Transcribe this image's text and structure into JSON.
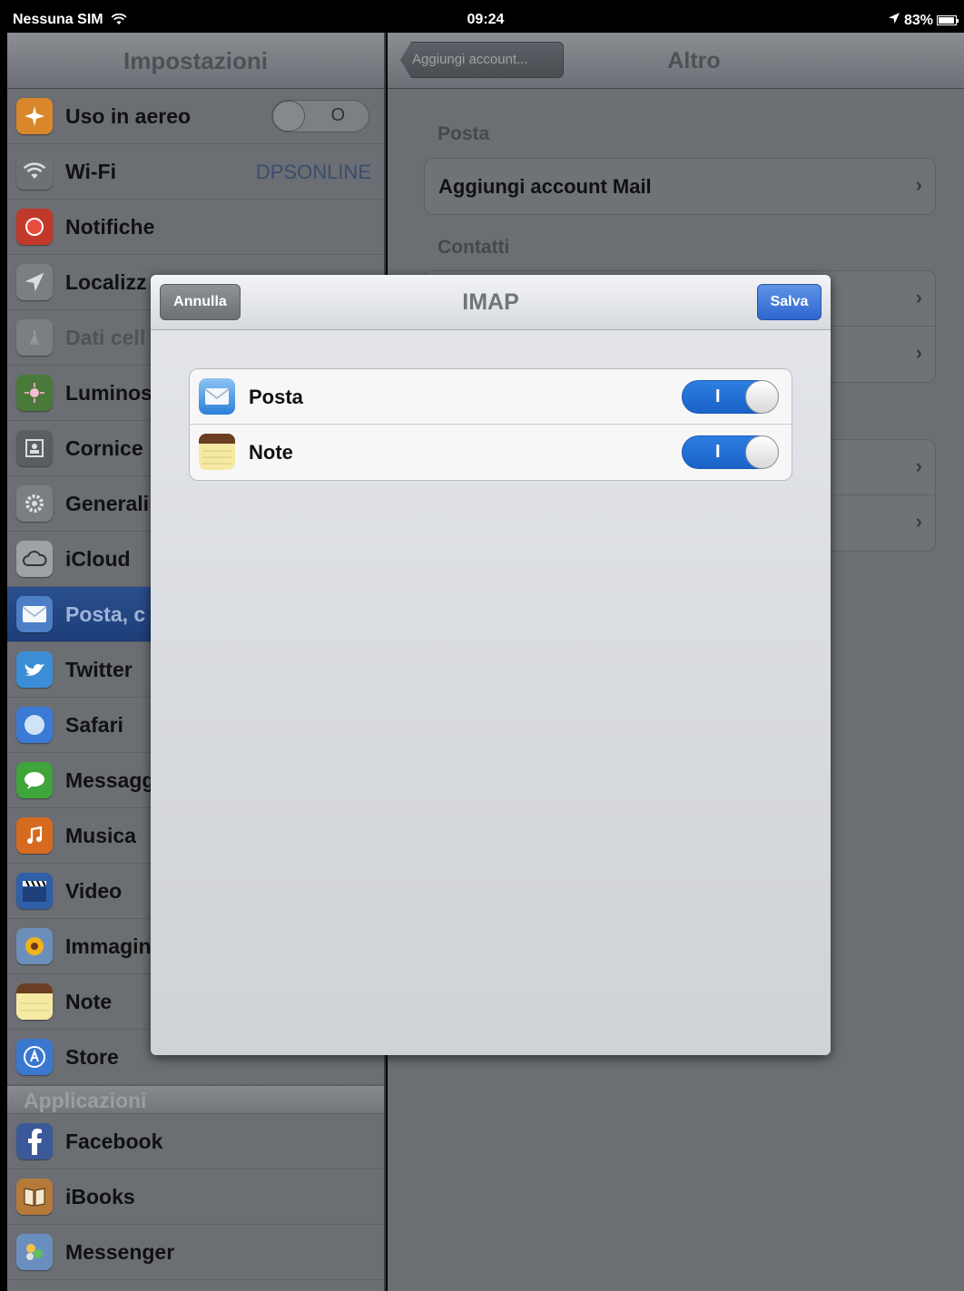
{
  "status_bar": {
    "carrier": "Nessuna SIM",
    "wifi_icon": "wifi-icon",
    "time": "09:24",
    "location_icon": "location-arrow-icon",
    "battery_percent": "83%",
    "battery_level": 0.83
  },
  "sidebar": {
    "title": "Impostazioni",
    "items": [
      {
        "label": "Uso in aereo",
        "icon": "airplane-icon",
        "color": "#d9872a",
        "toggle": "off",
        "toggle_mark": "O"
      },
      {
        "label": "Wi-Fi",
        "icon": "wifi-icon",
        "color": "#6d7075",
        "value": "DPSONLINE"
      },
      {
        "label": "Notifiche",
        "icon": "notifications-icon",
        "color": "#c0392b"
      },
      {
        "label": "Localizz",
        "icon": "location-icon",
        "color": "#7b7e83"
      },
      {
        "label": "Dati cell",
        "icon": "cellular-icon",
        "color": "#7b7e83",
        "disabled": true
      },
      {
        "label": "Luminos",
        "icon": "brightness-icon",
        "color": "#4a7a3a"
      },
      {
        "label": "Cornice",
        "icon": "picture-frame-icon",
        "color": "#5a5d62"
      },
      {
        "label": "Generali",
        "icon": "gear-icon",
        "color": "#7b7e83"
      },
      {
        "label": "iCloud",
        "icon": "cloud-icon",
        "color": "#9ea1a6"
      },
      {
        "label": "Posta, c",
        "icon": "mail-icon",
        "color": "#4d7fc7",
        "selected": true
      },
      {
        "label": "Twitter",
        "icon": "twitter-icon",
        "color": "#3b8ed6"
      },
      {
        "label": "Safari",
        "icon": "compass-icon",
        "color": "#3b7bd6"
      },
      {
        "label": "Messagg",
        "icon": "message-bubble-icon",
        "color": "#3fa43a"
      },
      {
        "label": "Musica",
        "icon": "music-note-icon",
        "color": "#d66a1f"
      },
      {
        "label": "Video",
        "icon": "clapperboard-icon",
        "color": "#2e5fa8"
      },
      {
        "label": "Immagin",
        "icon": "sunflower-icon",
        "color": "#6b8fb8"
      },
      {
        "label": "Note",
        "icon": "notepad-icon",
        "color": "#e8d98a"
      },
      {
        "label": "Store",
        "icon": "app-store-icon",
        "color": "#3a78d0"
      }
    ],
    "section_header": "Applicazioni",
    "apps": [
      {
        "label": "Facebook",
        "icon": "facebook-icon",
        "color": "#3b5998"
      },
      {
        "label": "iBooks",
        "icon": "book-icon",
        "color": "#b57a3a"
      },
      {
        "label": "Messenger",
        "icon": "messenger-icon",
        "color": "#6a8fbf"
      }
    ]
  },
  "detail": {
    "back_label": "Aggiungi account...",
    "title": "Altro",
    "posta_header": "Posta",
    "add_mail": "Aggiungi account Mail",
    "contatti_header": "Contatti",
    "chevron": "›"
  },
  "modal": {
    "title": "IMAP",
    "cancel": "Annulla",
    "save": "Salva",
    "rows": [
      {
        "label": "Posta",
        "icon": "mail-icon",
        "on": true,
        "mark": "I"
      },
      {
        "label": "Note",
        "icon": "notepad-icon",
        "on": true,
        "mark": "I"
      }
    ]
  }
}
